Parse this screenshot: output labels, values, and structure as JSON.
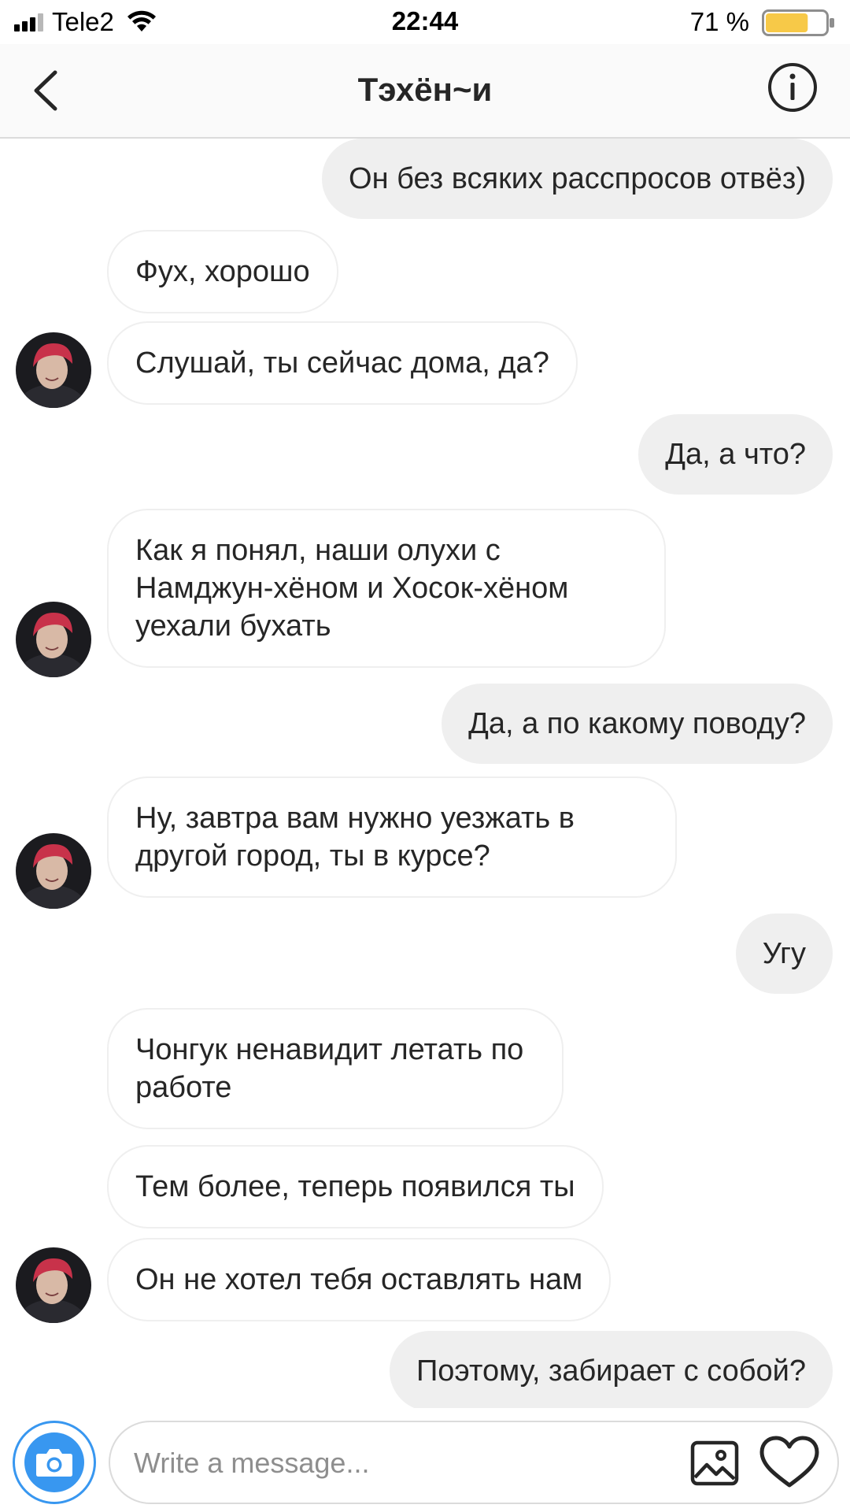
{
  "status_bar": {
    "carrier": "Tele2",
    "time": "22:44",
    "battery_percent": "71 %",
    "battery_level": 0.71,
    "signal_bars": 3,
    "icons": [
      "signal-icon",
      "wifi-icon",
      "battery-icon"
    ]
  },
  "header": {
    "title": "Тэхён~и",
    "back_icon": "chevron-left-icon",
    "info_icon": "info-icon"
  },
  "messages": [
    {
      "side": "out",
      "text": "Он без всяких расспросов отвёз)"
    },
    {
      "side": "in",
      "text": "Фух, хорошо"
    },
    {
      "side": "in",
      "text": "Слушай, ты сейчас дома, да?"
    },
    {
      "side": "out",
      "text": "Да, а что?"
    },
    {
      "side": "in",
      "text": "Как я понял, наши олухи с Намджун-хёном и Хосок-хёном уехали бухать"
    },
    {
      "side": "out",
      "text": "Да, а по какому поводу?"
    },
    {
      "side": "in",
      "text": "Ну, завтра вам нужно уезжать в другой город, ты в курсе?"
    },
    {
      "side": "out",
      "text": "Угу"
    },
    {
      "side": "in",
      "text": "Чонгук ненавидит летать по работе"
    },
    {
      "side": "in",
      "text": "Тем более, теперь появился ты"
    },
    {
      "side": "in",
      "text": "Он не хотел тебя оставлять нам"
    },
    {
      "side": "out",
      "text": "Поэтому, забирает с собой?"
    }
  ],
  "composer": {
    "placeholder": "Write a message...",
    "value": "",
    "camera_icon": "camera-icon",
    "gallery_icon": "gallery-icon",
    "like_icon": "heart-icon"
  },
  "colors": {
    "accent": "#3897f0",
    "outgoing_bubble": "#efefef",
    "incoming_border": "#efefef",
    "text": "#262626",
    "placeholder": "#8e8e8e",
    "battery_fill": "#f7c948"
  }
}
